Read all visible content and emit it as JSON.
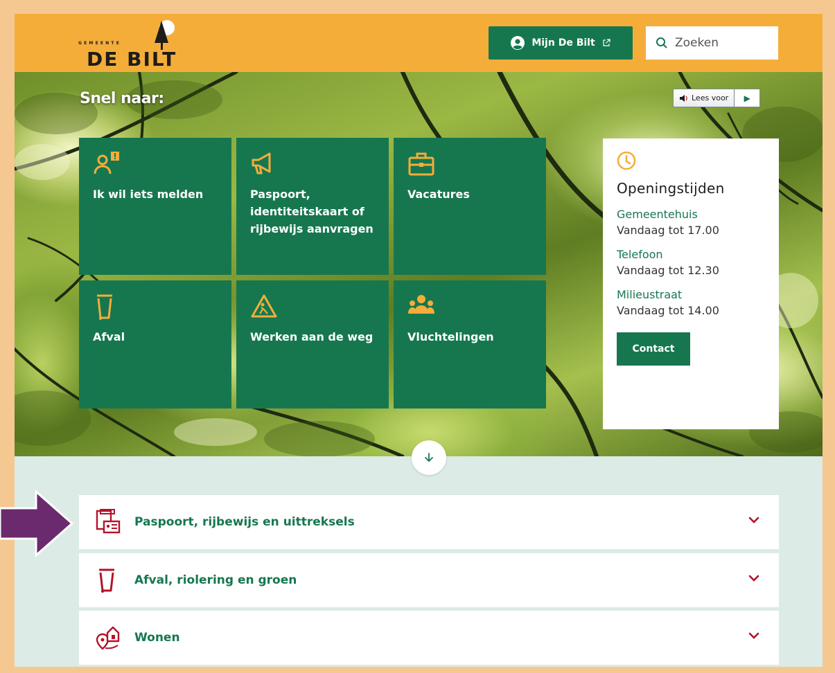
{
  "header": {
    "logo_top": "GEMEENTE",
    "logo_main": "DE BILT",
    "mijn_label": "Mijn De Bilt",
    "search_placeholder": "Zoeken"
  },
  "hero": {
    "snel_title": "Snel naar:",
    "lees_voor": "Lees voor"
  },
  "tiles": [
    {
      "label": "Ik wil iets melden",
      "icon": "report-person-icon"
    },
    {
      "label": "Paspoort, identiteitskaart of rijbewijs aanvragen",
      "icon": "megaphone-icon"
    },
    {
      "label": "Vacatures",
      "icon": "briefcase-icon"
    },
    {
      "label": "Afval",
      "icon": "trash-bin-icon"
    },
    {
      "label": "Werken aan de weg",
      "icon": "roadwork-sign-icon"
    },
    {
      "label": "Vluchtelingen",
      "icon": "people-group-icon"
    }
  ],
  "opening": {
    "title": "Openingstijden",
    "entries": [
      {
        "name": "Gemeentehuis",
        "time": "Vandaag tot 17.00"
      },
      {
        "name": "Telefoon",
        "time": "Vandaag tot 12.30"
      },
      {
        "name": "Milieustraat",
        "time": "Vandaag tot 14.00"
      }
    ],
    "contact_label": "Contact"
  },
  "accordion": [
    {
      "label": "Paspoort, rijbewijs en uittreksels",
      "icon": "id-documents-icon"
    },
    {
      "label": "Afval, riolering en groen",
      "icon": "trash-bin-icon"
    },
    {
      "label": "Wonen",
      "icon": "house-location-icon"
    }
  ],
  "colors": {
    "brand_green": "#16774f",
    "header_orange": "#f5ad3a",
    "icon_orange": "#f5ad3a",
    "icon_red": "#b3122a",
    "arrow_purple": "#6b2a6e"
  }
}
